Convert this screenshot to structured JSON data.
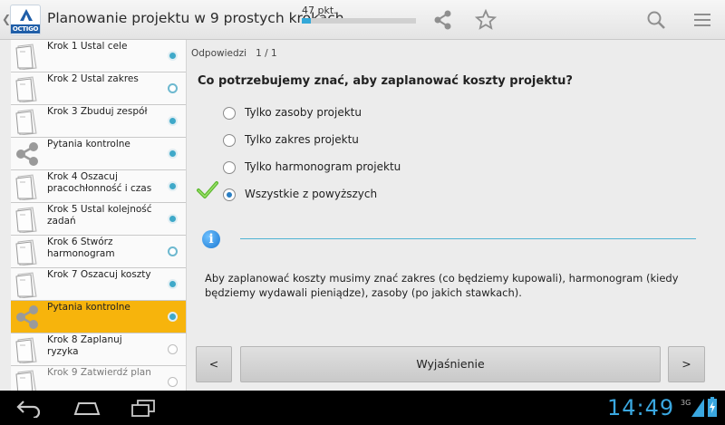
{
  "app": {
    "title": "Planowanie projektu w 9 prostych krokach",
    "logo_text": "OCTIGO",
    "points_label": "47 pkt.",
    "progress_fraction": 0.08
  },
  "actionbar_icons": [
    "share-icon",
    "star-icon",
    "search-icon",
    "menu-icon"
  ],
  "sidebar": {
    "items": [
      {
        "label": "Krok 1 Ustal cele",
        "icon": "document-icon",
        "status": "filled",
        "active": false
      },
      {
        "label": "Krok 2 Ustal zakres",
        "icon": "document-icon",
        "status": "ring",
        "active": false
      },
      {
        "label": "Krok 3 Zbuduj zespół",
        "icon": "document-icon",
        "status": "filled",
        "active": false
      },
      {
        "label": "Pytania kontrolne",
        "icon": "share-icon",
        "status": "filled",
        "active": false
      },
      {
        "label": "Krok 4 Oszacuj pracochłonność i czas",
        "icon": "document-icon",
        "status": "filled",
        "active": false
      },
      {
        "label": "Krok 5 Ustal kolejność zadań",
        "icon": "document-icon",
        "status": "filled",
        "active": false
      },
      {
        "label": "Krok 6 Stwórz harmonogram",
        "icon": "document-icon",
        "status": "ring",
        "active": false
      },
      {
        "label": "Krok 7 Oszacuj koszty",
        "icon": "document-icon",
        "status": "filled",
        "active": false
      },
      {
        "label": "Pytania kontrolne",
        "icon": "share-icon",
        "status": "filled",
        "active": true
      },
      {
        "label": "Krok 8 Zaplanuj ryzyka",
        "icon": "document-icon",
        "status": "empty",
        "active": false
      },
      {
        "label": "Krok 9 Zatwierdź plan",
        "icon": "document-icon",
        "status": "empty",
        "active": false
      }
    ]
  },
  "main": {
    "answers_label": "Odpowiedzi",
    "answers_count": "1 / 1",
    "question": "Co potrzebujemy znać, aby zaplanować koszty projektu?",
    "options": [
      {
        "label": "Tylko zasoby projektu",
        "checked": false
      },
      {
        "label": "Tylko zakres projektu",
        "checked": false
      },
      {
        "label": "Tylko harmonogram projektu",
        "checked": false
      },
      {
        "label": "Wszystkie z powyższych",
        "checked": true
      }
    ],
    "explanation": "Aby zaplanować koszty musimy znać zakres (co będziemy kupowali), harmonogram (kiedy będziemy wydawali pieniądze), zasoby (po jakich stawkach).",
    "prev_label": "<",
    "explain_label": "Wyjaśnienie",
    "next_label": ">"
  },
  "statusbar": {
    "time": "14:49",
    "network": "3G"
  },
  "colors": {
    "accent": "#33a8d8",
    "active_item": "#f7b40c",
    "clock": "#3aa7e0"
  }
}
